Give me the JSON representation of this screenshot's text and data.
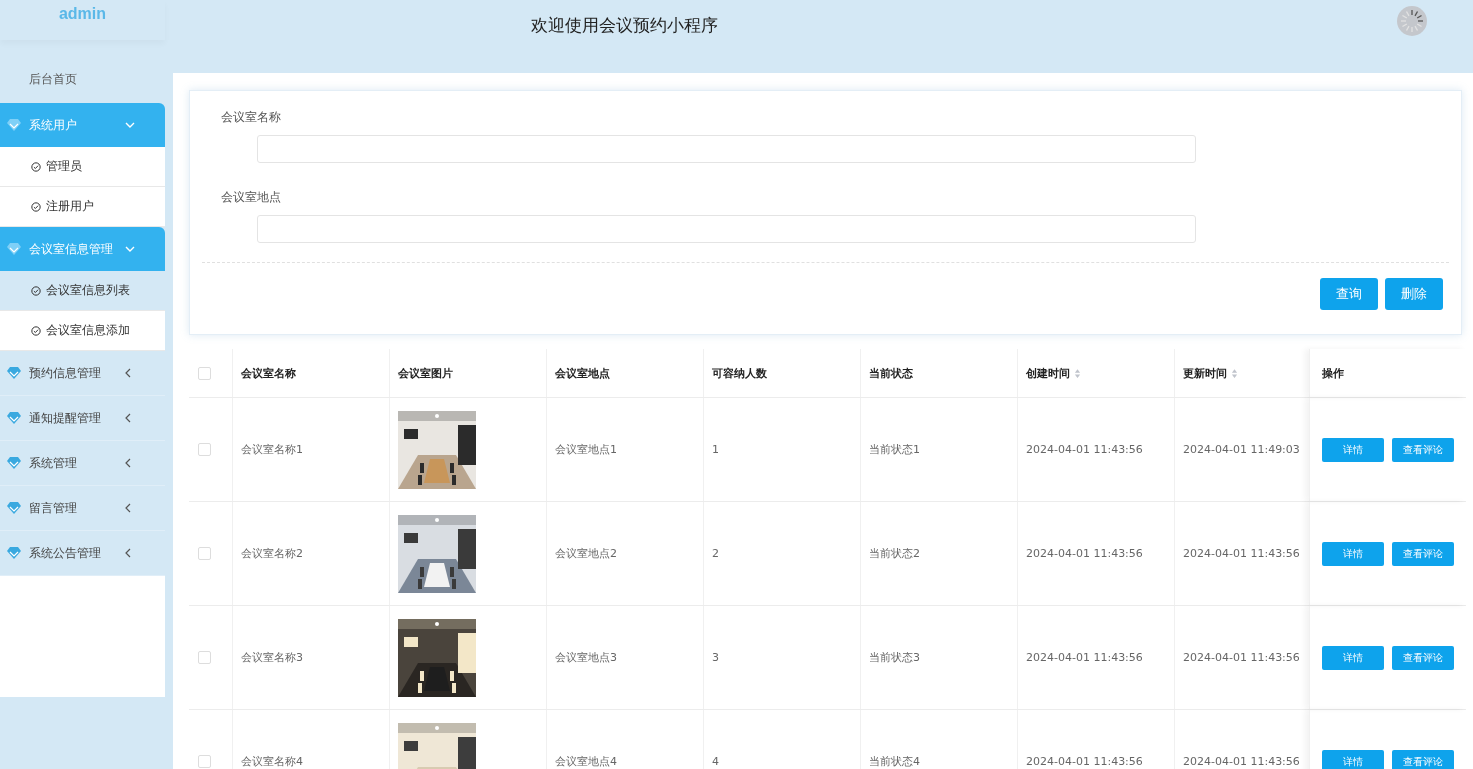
{
  "header": {
    "brand": "admin",
    "title": "欢迎使用会议预约小程序"
  },
  "sidebar": {
    "items": [
      {
        "kind": "link",
        "label": "后台首页"
      },
      {
        "kind": "group",
        "label": "系统用户",
        "expanded": true,
        "children": [
          {
            "label": "管理员",
            "selected": false
          },
          {
            "label": "注册用户",
            "selected": false
          }
        ]
      },
      {
        "kind": "group",
        "label": "会议室信息管理",
        "expanded": true,
        "children": [
          {
            "label": "会议室信息列表",
            "selected": true
          },
          {
            "label": "会议室信息添加",
            "selected": false
          }
        ]
      },
      {
        "kind": "group",
        "label": "预约信息管理",
        "expanded": false
      },
      {
        "kind": "group",
        "label": "通知提醒管理",
        "expanded": false
      },
      {
        "kind": "group",
        "label": "系统管理",
        "expanded": false
      },
      {
        "kind": "group",
        "label": "留言管理",
        "expanded": false
      },
      {
        "kind": "group",
        "label": "系统公告管理",
        "expanded": false
      }
    ]
  },
  "search": {
    "fields": [
      {
        "label": "会议室名称"
      },
      {
        "label": "会议室地点"
      }
    ],
    "buttons": [
      "查询",
      "删除"
    ]
  },
  "table": {
    "select_all": {
      "checked": false
    },
    "columns": [
      {
        "label": "会议室名称",
        "sortable": false
      },
      {
        "label": "会议室图片",
        "sortable": false
      },
      {
        "label": "会议室地点",
        "sortable": false
      },
      {
        "label": "可容纳人数",
        "sortable": false
      },
      {
        "label": "当前状态",
        "sortable": false
      },
      {
        "label": "创建时间",
        "sortable": true
      },
      {
        "label": "更新时间",
        "sortable": true
      },
      {
        "label": "操作",
        "sortable": false
      }
    ],
    "rows": [
      {
        "checked": false,
        "name": "会议室名称1",
        "location": "会议室地点1",
        "capacity": "1",
        "status": "当前状态1",
        "created": "2024-04-01 11:43:56",
        "updated": "2024-04-01 11:49:03",
        "actions": [
          "详情",
          "查看评论"
        ]
      },
      {
        "checked": false,
        "name": "会议室名称2",
        "location": "会议室地点2",
        "capacity": "2",
        "status": "当前状态2",
        "created": "2024-04-01 11:43:56",
        "updated": "2024-04-01 11:43:56",
        "actions": [
          "详情",
          "查看评论"
        ]
      },
      {
        "checked": false,
        "name": "会议室名称3",
        "location": "会议室地点3",
        "capacity": "3",
        "status": "当前状态3",
        "created": "2024-04-01 11:43:56",
        "updated": "2024-04-01 11:43:56",
        "actions": [
          "详情",
          "查看评论"
        ]
      },
      {
        "checked": false,
        "name": "会议室名称4",
        "location": "会议室地点4",
        "capacity": "4",
        "status": "当前状态4",
        "created": "2024-04-01 11:43:56",
        "updated": "2024-04-01 11:43:56",
        "actions": [
          "详情",
          "查看评论"
        ]
      }
    ]
  }
}
